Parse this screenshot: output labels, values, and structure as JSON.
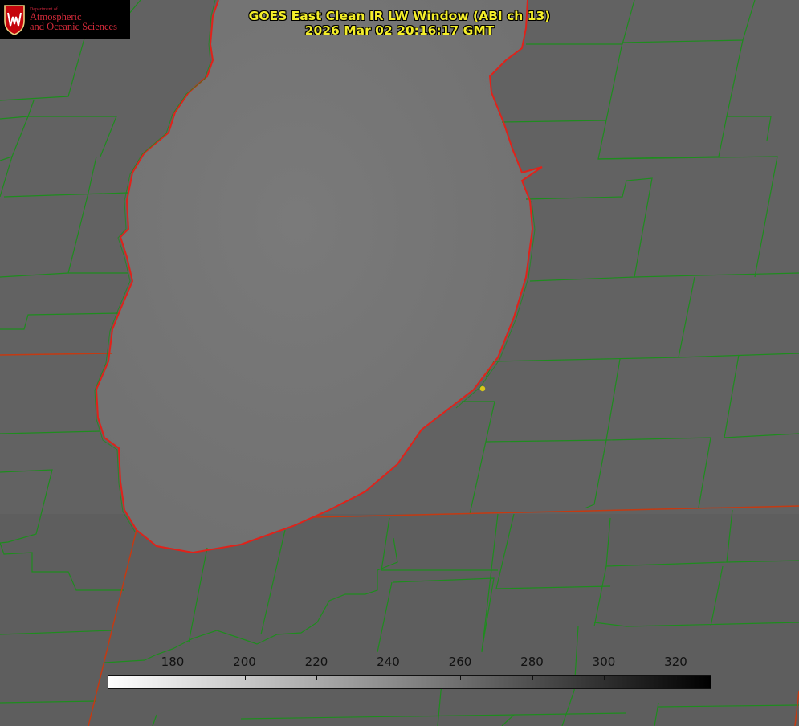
{
  "title": {
    "line1": "GOES East Clean IR LW Window (ABI ch 13)",
    "line2": "2026 Mar 02 20:16:17 GMT"
  },
  "logo": {
    "dept": "Department of",
    "line1": "Atmospheric",
    "line2": "and Oceanic Sciences",
    "crest_icon": "uw-crest-icon"
  },
  "colorbar": {
    "ticks": [
      "180",
      "200",
      "220",
      "240",
      "260",
      "280",
      "300",
      "320"
    ],
    "gradient": "white-to-black"
  },
  "colors": {
    "county_lines": "#1e8c1e",
    "state_lines": "#c43a12",
    "lake_outline": "#e0221a",
    "title_text": "#f4ee2a",
    "station_marker": "#d8c818"
  }
}
